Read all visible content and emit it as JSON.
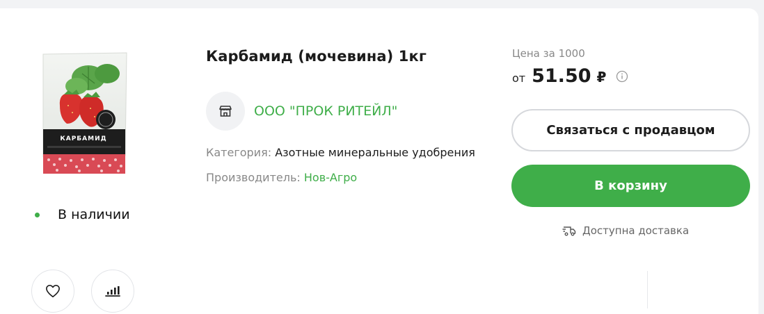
{
  "product": {
    "title": "Карбамид (мочевина) 1кг",
    "image_alt": "Карбамид package with strawberries",
    "package_text": "КАРБАМИД",
    "stock_label": "В наличии"
  },
  "seller": {
    "name": "ООО \"ПРОК РИТЕЙЛ\"",
    "icon": "store-icon"
  },
  "meta": {
    "category_label": "Категория:",
    "category_value": "Азотные минеральные удобрения",
    "manufacturer_label": "Производитель:",
    "manufacturer_value": "Нов-Агро"
  },
  "price": {
    "caption": "Цена за 1000",
    "from": "от",
    "value": "51.50",
    "currency": "₽"
  },
  "actions": {
    "contact_label": "Связаться с продавцом",
    "cart_label": "В корзину",
    "delivery_label": "Доступна доставка"
  },
  "colors": {
    "accent": "#3fae49",
    "text": "#1c1c1c",
    "muted": "#888888"
  },
  "icons": {
    "favorite": "heart-icon",
    "compare": "compare-bars-icon",
    "info": "info-icon",
    "delivery": "delivery-truck-icon"
  }
}
